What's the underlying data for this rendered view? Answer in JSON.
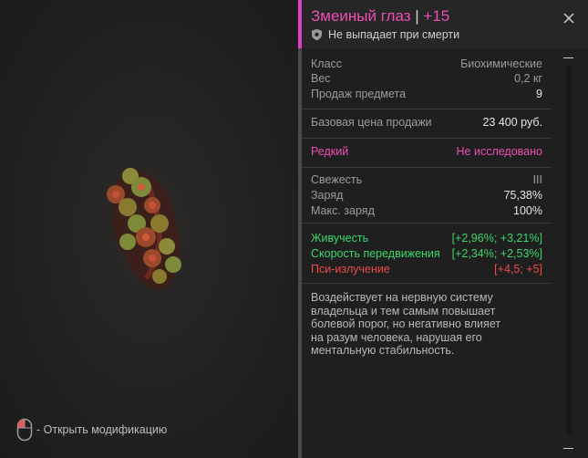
{
  "item": {
    "name": "Змеиный глаз",
    "separator": " | ",
    "upgrade": "+15",
    "drop_note": "Не выпадает при смерти"
  },
  "colors": {
    "accent": "#ee4fb5",
    "positive": "#3ed66e",
    "negative": "#ef4b4b"
  },
  "info": {
    "class_label": "Класс",
    "class_value": "Биохимические",
    "weight_label": "Вес",
    "weight_value": "0,2 кг",
    "sell_label": "Продаж предмета",
    "sell_value": "9"
  },
  "price": {
    "label": "Базовая цена продажи",
    "value": "23 400 руб."
  },
  "rarity": {
    "label": "Редкий",
    "status": "Не исследовано"
  },
  "condition": {
    "freshness_label": "Свежесть",
    "freshness_value": "III",
    "charge_label": "Заряд",
    "charge_value": "75,38%",
    "max_charge_label": "Макс. заряд",
    "max_charge_value": "100%"
  },
  "effects": [
    {
      "name": "Живучесть",
      "value": "[+2,96%; +3,21%]"
    },
    {
      "name": "Скорость передвижения",
      "value": "[+2,34%; +2,53%]"
    },
    {
      "name": "Пси-излучение",
      "value": "[+4,5; +5]"
    }
  ],
  "description": "Воздействует на нервную систему владельца и тем самым повышает болевой порог, но негативно влияет на разум человека, нарушая его ментальную стабильность.",
  "hint": {
    "icon": "mouse-icon",
    "text": "- Открыть модификацию"
  }
}
